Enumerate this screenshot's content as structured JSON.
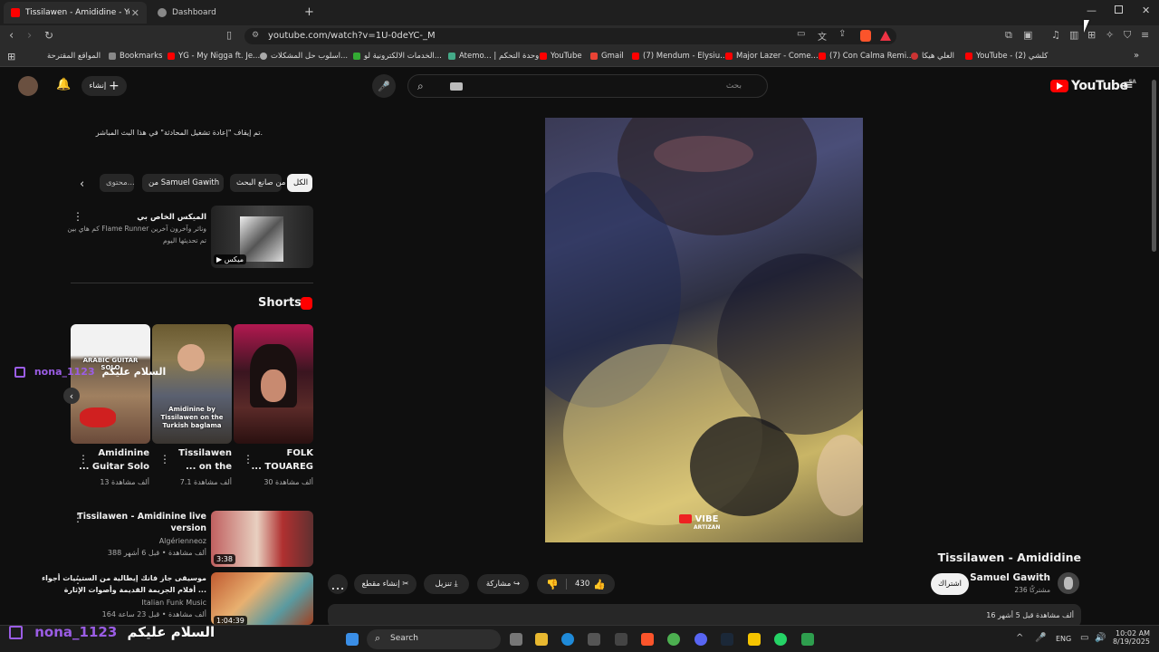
{
  "browser": {
    "tabs": [
      {
        "label": "Tissilawen - Amididine - You",
        "active": true
      },
      {
        "label": "Dashboard",
        "active": false
      }
    ],
    "url": "youtube.com/watch?v=1U-0deYC-_M",
    "bookmarks": [
      "المواقع المقترحة",
      "Bookmarks",
      "YG - My Nigga ft. Je...",
      "اسلوب حل المشكلات...",
      "الخدمات الالكترونية لو...",
      "Atemo... | وحدة التحكم",
      "YouTube",
      "Gmail",
      "(7) Mendum - Elysiu...",
      "Major Lazer - Come...",
      "(7) Con Calma Remi...",
      "العلي هيكا",
      "YouTube - كلشي (2)"
    ]
  },
  "youtube": {
    "logo": "YouTube",
    "logo_region": "SA",
    "create_label": "إنشاء",
    "search_placeholder": "بحث",
    "notice": "تم إيقاف \"إعادة تشغيل المحادثة\" في هذا البث المباشر.",
    "chips": [
      "الكل",
      "من صانع البحث",
      "من Samuel Gawith",
      "محتوى..."
    ],
    "mix": {
      "title": "الميكس الخاص بي",
      "subtitle": "كم هاي بين Flame Runner وناثر وآخرون آخرين",
      "subtitle2": "تم تحديثها اليوم",
      "badge": "ميكس"
    },
    "shorts_heading": "Shorts",
    "shorts": [
      {
        "title": "FOLK",
        "title2": "... TOUAREG",
        "views": "30 ألف مشاهدة"
      },
      {
        "title": "Tissilawen",
        "title2": "... on the",
        "views": "7.1 ألف مشاهدة"
      },
      {
        "title": "Amidinine",
        "title2": "... Guitar Solo",
        "views": "13 ألف مشاهدة"
      }
    ],
    "short_thumb_texts": [
      "ARABIC GUITAR SOLO",
      "Amidinine by Tissilawen on the Turkish baglama"
    ],
    "related": [
      {
        "title": "Tissilawen - Amidinine live",
        "title2": "version",
        "channel": "Algérienneoz",
        "meta": "388 ألف مشاهدة • قبل 6 أشهر",
        "duration": "3:38"
      },
      {
        "title": "موسيقى جاز فانك إيطالية من الستينيات أجواء",
        "title2": "أفلام الجريمة القديمة وأصوات الإثارة ...",
        "channel": "Italian Funk Music",
        "meta": "164 ألف مشاهدة • قبل 23 ساعة",
        "duration": "1:04:39"
      }
    ],
    "video": {
      "title": "Tissilawen - Amididine",
      "watermark": "VIBE",
      "watermark2": "ARTIZAN",
      "channel": "Samuel Gawith",
      "subscribers": "236 مشتركًا",
      "subscribe_label": "اشتراك",
      "likes": "430",
      "share_label": "مشاركة",
      "download_label": "تنزيل",
      "clip_label": "إنشاء مقطع",
      "more_label": "...",
      "description_meta": "16 ألف مشاهدة قبل 5 أشهر"
    }
  },
  "stream_overlay": {
    "username": "nona_1123",
    "message": "السلام عليكم"
  },
  "taskbar": {
    "search_label": "Search",
    "lang": "ENG",
    "time": "10:02 AM",
    "date": "8/19/2025"
  },
  "colors": {
    "accent_red": "#ff0000",
    "overlay_purple": "#9b5de5"
  }
}
